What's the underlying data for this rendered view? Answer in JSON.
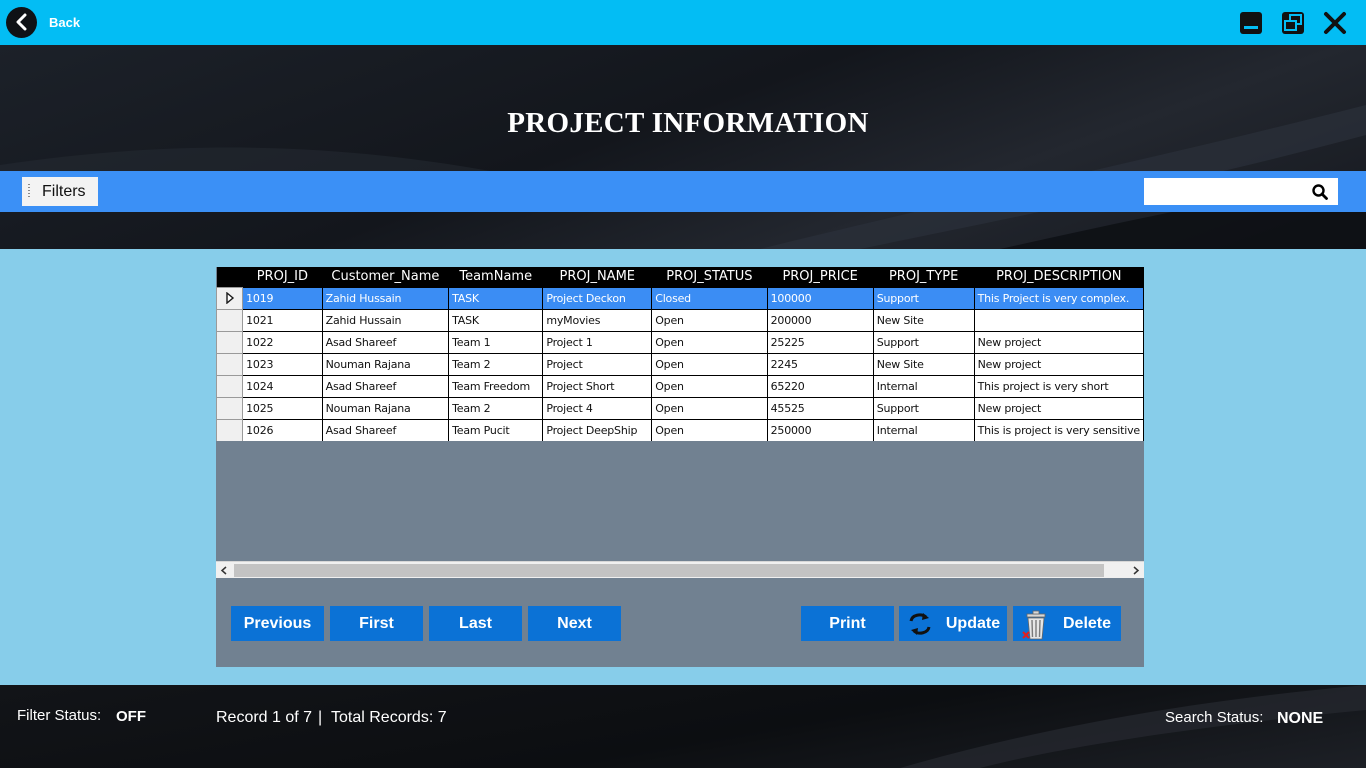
{
  "topbar": {
    "back_label": "Back",
    "bg_color": "#03bdf4"
  },
  "header": {
    "title": "PROJECT INFORMATION"
  },
  "toolstrip": {
    "filters_label": "Filters",
    "search": {
      "value": "",
      "placeholder": ""
    }
  },
  "grid": {
    "columns": [
      "PROJ_ID",
      "Customer_Name",
      "TeamName",
      "PROJ_NAME",
      "PROJ_STATUS",
      "PROJ_PRICE",
      "PROJ_TYPE",
      "PROJ_DESCRIPTION"
    ],
    "rows": [
      [
        "1019",
        "Zahid  Hussain",
        "TASK",
        "Project Deckon",
        "Closed",
        "100000",
        "Support",
        "This Project is very complex."
      ],
      [
        "1021",
        "Zahid  Hussain",
        "TASK",
        "myMovies",
        "Open",
        "200000",
        "New Site",
        ""
      ],
      [
        "1022",
        "Asad  Shareef",
        "Team 1",
        "Project 1",
        "Open",
        "25225",
        "Support",
        "New project"
      ],
      [
        "1023",
        "Nouman  Rajana",
        "Team 2",
        "Project",
        "Open",
        "2245",
        "New Site",
        "New project"
      ],
      [
        "1024",
        "Asad  Shareef",
        "Team Freedom",
        "Project Short",
        "Open",
        "65220",
        "Internal",
        "This project is very short"
      ],
      [
        "1025",
        "Nouman  Rajana",
        "Team 2",
        "Project 4",
        "Open",
        "45525",
        "Support",
        "New project"
      ],
      [
        "1026",
        "Asad  Shareef",
        "Team Pucit",
        "Project DeepShip",
        "Open",
        "250000",
        "Internal",
        "This is project is very sensitive"
      ]
    ],
    "selected_row": 0,
    "selection_color": "#3b8df4"
  },
  "buttons": {
    "previous": "Previous",
    "first": "First",
    "last": "Last",
    "next": "Next",
    "print": "Print",
    "update": "Update",
    "delete": "Delete",
    "color": "#0b72d6"
  },
  "footer": {
    "filter_status_label": "Filter Status:",
    "filter_status_value": "OFF",
    "record_text": "Record 1 of 7",
    "separator": "|",
    "total_records_text": "Total Records: 7",
    "search_status_label": "Search Status:",
    "search_status_value": "NONE"
  }
}
